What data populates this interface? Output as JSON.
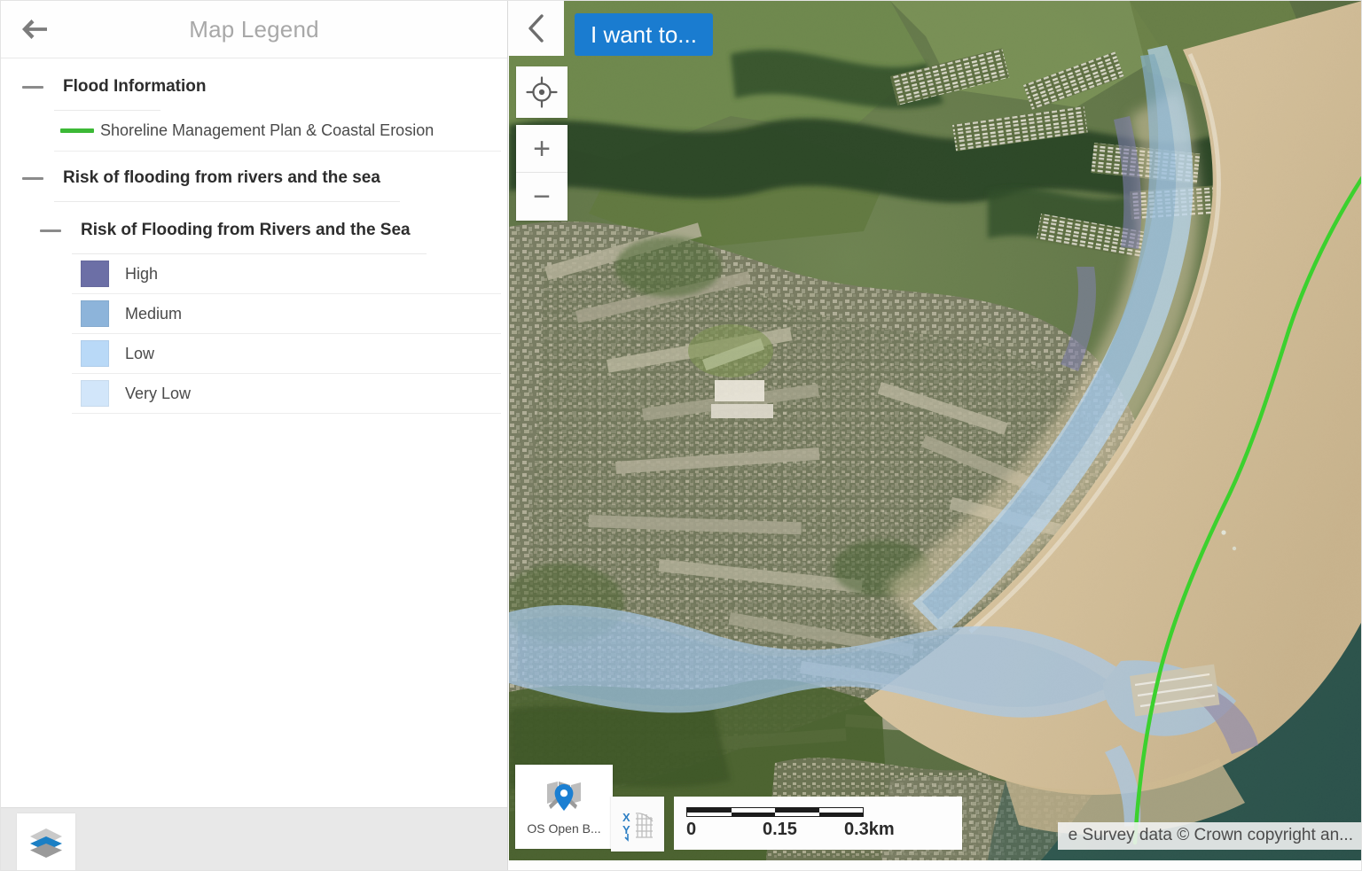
{
  "panel": {
    "title": "Map Legend",
    "back_icon": "back-arrow-icon",
    "groups": [
      {
        "label": "Flood Information",
        "level": 1,
        "collapse_icon": "minus-icon",
        "items": [
          {
            "label": "Shoreline Management Plan & Coastal Erosion",
            "symbol": "line",
            "color": "#3cb936"
          }
        ]
      },
      {
        "label": "Risk of flooding from rivers and the sea",
        "level": 1,
        "collapse_icon": "minus-icon",
        "subgroups": [
          {
            "label": "Risk of Flooding from Rivers and the Sea",
            "level": 2,
            "collapse_icon": "minus-icon",
            "items": [
              {
                "label": "High",
                "symbol": "swatch",
                "color": "#6c6fa6"
              },
              {
                "label": "Medium",
                "symbol": "swatch",
                "color": "#8db4da"
              },
              {
                "label": "Low",
                "symbol": "swatch",
                "color": "#b9d9f7"
              },
              {
                "label": "Very Low",
                "symbol": "swatch",
                "color": "#d2e6fa"
              }
            ]
          }
        ]
      }
    ],
    "footer": {
      "layers_button_label": "layers-icon"
    }
  },
  "map": {
    "collapse_icon": "chevron-left-icon",
    "geolocate_icon": "crosshair-icon",
    "zoom_in_label": "+",
    "zoom_out_label": "−",
    "i_want_to_label": "I want to...",
    "i_want_to_color": "#1a7cd0",
    "basemap": {
      "label": "OS Open B...",
      "icon": "map-pin-icon"
    },
    "coordinates_icon": "xy-grid-icon",
    "scalebar": {
      "label_start": "0",
      "label_mid": "0.15",
      "label_end": "0.3km"
    },
    "attribution": "e Survey data © Crown copyright an...",
    "colors": {
      "sea": "#34605a",
      "sand": "#d5c29d",
      "vegetation": "#4e6640",
      "flood_overlay": "#a9c9e9",
      "smp_line": "#3cd22f"
    }
  }
}
